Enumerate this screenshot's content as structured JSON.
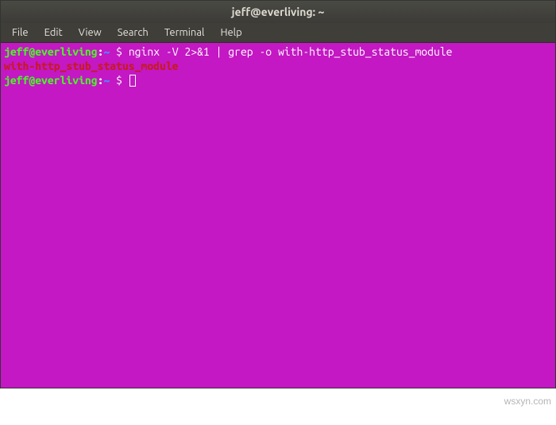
{
  "titlebar": {
    "title": "jeff@everliving: ~"
  },
  "menubar": {
    "items": [
      "File",
      "Edit",
      "View",
      "Search",
      "Terminal",
      "Help"
    ]
  },
  "terminal": {
    "lines": [
      {
        "prompt_user": "jeff@everliving",
        "prompt_sep": ":",
        "prompt_path": "~",
        "dollar": " $ ",
        "command": "nginx -V 2>&1 | grep -o with-http_stub_status_module"
      },
      {
        "output_match": "with-http_stub_status_module"
      },
      {
        "prompt_user": "jeff@everliving",
        "prompt_sep": ":",
        "prompt_path": "~",
        "dollar": " $ ",
        "cursor": true
      }
    ]
  },
  "watermark": "wsxyn.com"
}
